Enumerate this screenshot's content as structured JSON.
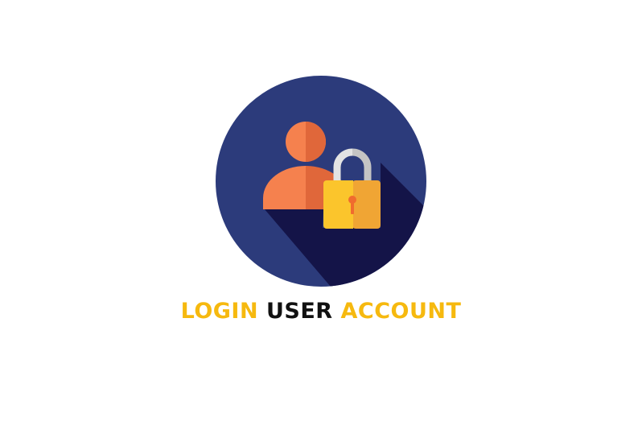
{
  "headline": {
    "word1": "LOGIN",
    "word2": "USER",
    "word3": "ACCOUNT"
  },
  "emblem": {
    "icon": "user-lock-icon",
    "colors": {
      "circle": "#2c3b7b",
      "shadow": "#141448",
      "person_light": "#f5814e",
      "person_dark": "#e0673a",
      "shackle_light": "#e3e3e3",
      "shackle_dark": "#c4c4c4",
      "lock_light": "#fbc52c",
      "lock_dark": "#f0a534",
      "keyhole": "#f06b2e"
    }
  },
  "colors": {
    "accent": "#f6b90f",
    "dark_text": "#111111"
  }
}
